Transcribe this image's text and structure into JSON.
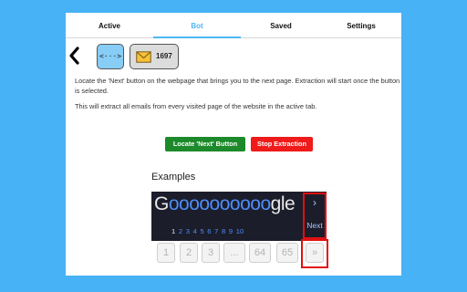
{
  "tabs": [
    {
      "label": "Active",
      "active": false
    },
    {
      "label": "Bot",
      "active": true
    },
    {
      "label": "Saved",
      "active": false
    },
    {
      "label": "Settings",
      "active": false
    }
  ],
  "toolbar": {
    "back_icon": "chevron-left-icon",
    "code_label": "<···>",
    "mail_icon": "envelope-icon",
    "email_count": "1697"
  },
  "description": {
    "line1": "Locate the 'Next' button on the webpage that brings you to the next page. Extraction will start once the button is selected.",
    "line2": "This will extract all emails from every visited page of the website in the active tab."
  },
  "actions": {
    "locate_label": "Locate 'Next' Button",
    "stop_label": "Stop Extraction"
  },
  "examples": {
    "heading": "Examples",
    "google": {
      "prefix": "G",
      "middle": "oooooooooo",
      "suffix": "gle",
      "pages": [
        "1",
        "2",
        "3",
        "4",
        "5",
        "6",
        "7",
        "8",
        "9",
        "10"
      ],
      "current_page": "1",
      "next_chevron": "›",
      "next_label": "Next"
    },
    "pagination": [
      "1",
      "2",
      "3",
      "...",
      "64",
      "65",
      "»"
    ]
  },
  "colors": {
    "background": "#47b2f5",
    "accent": "#4eb6f4",
    "locate_button": "#1c8a2a",
    "stop_button": "#ef1a1a",
    "highlight": "#e01010"
  }
}
